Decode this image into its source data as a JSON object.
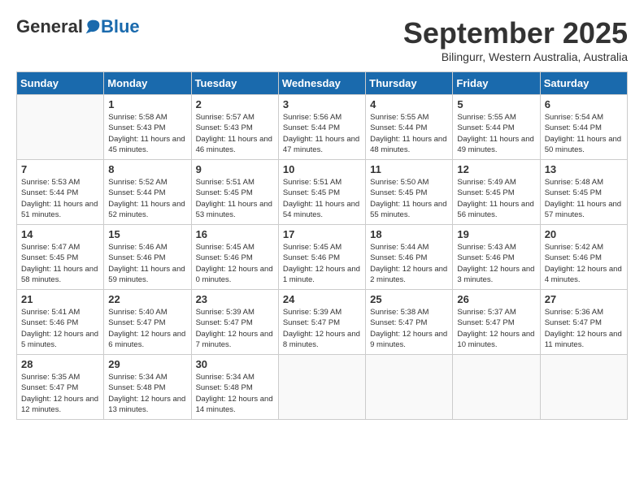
{
  "header": {
    "logo_general": "General",
    "logo_blue": "Blue",
    "month_title": "September 2025",
    "subtitle": "Bilingurr, Western Australia, Australia"
  },
  "days_of_week": [
    "Sunday",
    "Monday",
    "Tuesday",
    "Wednesday",
    "Thursday",
    "Friday",
    "Saturday"
  ],
  "weeks": [
    [
      {
        "day": "",
        "sunrise": "",
        "sunset": "",
        "daylight": ""
      },
      {
        "day": "1",
        "sunrise": "Sunrise: 5:58 AM",
        "sunset": "Sunset: 5:43 PM",
        "daylight": "Daylight: 11 hours and 45 minutes."
      },
      {
        "day": "2",
        "sunrise": "Sunrise: 5:57 AM",
        "sunset": "Sunset: 5:43 PM",
        "daylight": "Daylight: 11 hours and 46 minutes."
      },
      {
        "day": "3",
        "sunrise": "Sunrise: 5:56 AM",
        "sunset": "Sunset: 5:44 PM",
        "daylight": "Daylight: 11 hours and 47 minutes."
      },
      {
        "day": "4",
        "sunrise": "Sunrise: 5:55 AM",
        "sunset": "Sunset: 5:44 PM",
        "daylight": "Daylight: 11 hours and 48 minutes."
      },
      {
        "day": "5",
        "sunrise": "Sunrise: 5:55 AM",
        "sunset": "Sunset: 5:44 PM",
        "daylight": "Daylight: 11 hours and 49 minutes."
      },
      {
        "day": "6",
        "sunrise": "Sunrise: 5:54 AM",
        "sunset": "Sunset: 5:44 PM",
        "daylight": "Daylight: 11 hours and 50 minutes."
      }
    ],
    [
      {
        "day": "7",
        "sunrise": "Sunrise: 5:53 AM",
        "sunset": "Sunset: 5:44 PM",
        "daylight": "Daylight: 11 hours and 51 minutes."
      },
      {
        "day": "8",
        "sunrise": "Sunrise: 5:52 AM",
        "sunset": "Sunset: 5:44 PM",
        "daylight": "Daylight: 11 hours and 52 minutes."
      },
      {
        "day": "9",
        "sunrise": "Sunrise: 5:51 AM",
        "sunset": "Sunset: 5:45 PM",
        "daylight": "Daylight: 11 hours and 53 minutes."
      },
      {
        "day": "10",
        "sunrise": "Sunrise: 5:51 AM",
        "sunset": "Sunset: 5:45 PM",
        "daylight": "Daylight: 11 hours and 54 minutes."
      },
      {
        "day": "11",
        "sunrise": "Sunrise: 5:50 AM",
        "sunset": "Sunset: 5:45 PM",
        "daylight": "Daylight: 11 hours and 55 minutes."
      },
      {
        "day": "12",
        "sunrise": "Sunrise: 5:49 AM",
        "sunset": "Sunset: 5:45 PM",
        "daylight": "Daylight: 11 hours and 56 minutes."
      },
      {
        "day": "13",
        "sunrise": "Sunrise: 5:48 AM",
        "sunset": "Sunset: 5:45 PM",
        "daylight": "Daylight: 11 hours and 57 minutes."
      }
    ],
    [
      {
        "day": "14",
        "sunrise": "Sunrise: 5:47 AM",
        "sunset": "Sunset: 5:45 PM",
        "daylight": "Daylight: 11 hours and 58 minutes."
      },
      {
        "day": "15",
        "sunrise": "Sunrise: 5:46 AM",
        "sunset": "Sunset: 5:46 PM",
        "daylight": "Daylight: 11 hours and 59 minutes."
      },
      {
        "day": "16",
        "sunrise": "Sunrise: 5:45 AM",
        "sunset": "Sunset: 5:46 PM",
        "daylight": "Daylight: 12 hours and 0 minutes."
      },
      {
        "day": "17",
        "sunrise": "Sunrise: 5:45 AM",
        "sunset": "Sunset: 5:46 PM",
        "daylight": "Daylight: 12 hours and 1 minute."
      },
      {
        "day": "18",
        "sunrise": "Sunrise: 5:44 AM",
        "sunset": "Sunset: 5:46 PM",
        "daylight": "Daylight: 12 hours and 2 minutes."
      },
      {
        "day": "19",
        "sunrise": "Sunrise: 5:43 AM",
        "sunset": "Sunset: 5:46 PM",
        "daylight": "Daylight: 12 hours and 3 minutes."
      },
      {
        "day": "20",
        "sunrise": "Sunrise: 5:42 AM",
        "sunset": "Sunset: 5:46 PM",
        "daylight": "Daylight: 12 hours and 4 minutes."
      }
    ],
    [
      {
        "day": "21",
        "sunrise": "Sunrise: 5:41 AM",
        "sunset": "Sunset: 5:46 PM",
        "daylight": "Daylight: 12 hours and 5 minutes."
      },
      {
        "day": "22",
        "sunrise": "Sunrise: 5:40 AM",
        "sunset": "Sunset: 5:47 PM",
        "daylight": "Daylight: 12 hours and 6 minutes."
      },
      {
        "day": "23",
        "sunrise": "Sunrise: 5:39 AM",
        "sunset": "Sunset: 5:47 PM",
        "daylight": "Daylight: 12 hours and 7 minutes."
      },
      {
        "day": "24",
        "sunrise": "Sunrise: 5:39 AM",
        "sunset": "Sunset: 5:47 PM",
        "daylight": "Daylight: 12 hours and 8 minutes."
      },
      {
        "day": "25",
        "sunrise": "Sunrise: 5:38 AM",
        "sunset": "Sunset: 5:47 PM",
        "daylight": "Daylight: 12 hours and 9 minutes."
      },
      {
        "day": "26",
        "sunrise": "Sunrise: 5:37 AM",
        "sunset": "Sunset: 5:47 PM",
        "daylight": "Daylight: 12 hours and 10 minutes."
      },
      {
        "day": "27",
        "sunrise": "Sunrise: 5:36 AM",
        "sunset": "Sunset: 5:47 PM",
        "daylight": "Daylight: 12 hours and 11 minutes."
      }
    ],
    [
      {
        "day": "28",
        "sunrise": "Sunrise: 5:35 AM",
        "sunset": "Sunset: 5:47 PM",
        "daylight": "Daylight: 12 hours and 12 minutes."
      },
      {
        "day": "29",
        "sunrise": "Sunrise: 5:34 AM",
        "sunset": "Sunset: 5:48 PM",
        "daylight": "Daylight: 12 hours and 13 minutes."
      },
      {
        "day": "30",
        "sunrise": "Sunrise: 5:34 AM",
        "sunset": "Sunset: 5:48 PM",
        "daylight": "Daylight: 12 hours and 14 minutes."
      },
      {
        "day": "",
        "sunrise": "",
        "sunset": "",
        "daylight": ""
      },
      {
        "day": "",
        "sunrise": "",
        "sunset": "",
        "daylight": ""
      },
      {
        "day": "",
        "sunrise": "",
        "sunset": "",
        "daylight": ""
      },
      {
        "day": "",
        "sunrise": "",
        "sunset": "",
        "daylight": ""
      }
    ]
  ]
}
